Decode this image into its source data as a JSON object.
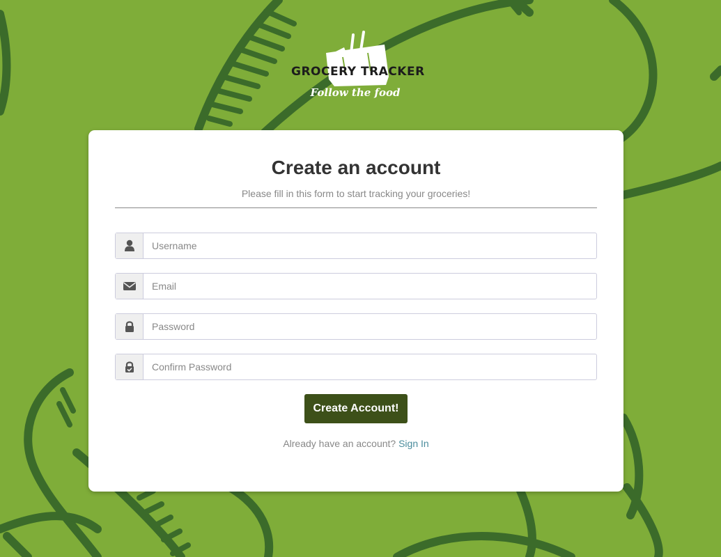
{
  "brand": {
    "name": "GROCERY TRACKER",
    "tagline": "Follow the food"
  },
  "form": {
    "title": "Create an account",
    "subtitle": "Please fill in this form to start tracking your groceries!",
    "fields": [
      {
        "icon": "user-icon",
        "placeholder": "Username",
        "value": ""
      },
      {
        "icon": "envelope-icon",
        "placeholder": "Email",
        "value": ""
      },
      {
        "icon": "lock-icon",
        "placeholder": "Password",
        "value": ""
      },
      {
        "icon": "lock-check-icon",
        "placeholder": "Confirm Password",
        "value": ""
      }
    ],
    "submit_label": "Create Account!",
    "signin_prompt": "Already have an account?",
    "signin_link": "Sign In"
  },
  "colors": {
    "background": "#7fad39",
    "pattern": "#3b6b2a",
    "button": "#3d5019",
    "link": "#4a8c9c"
  }
}
